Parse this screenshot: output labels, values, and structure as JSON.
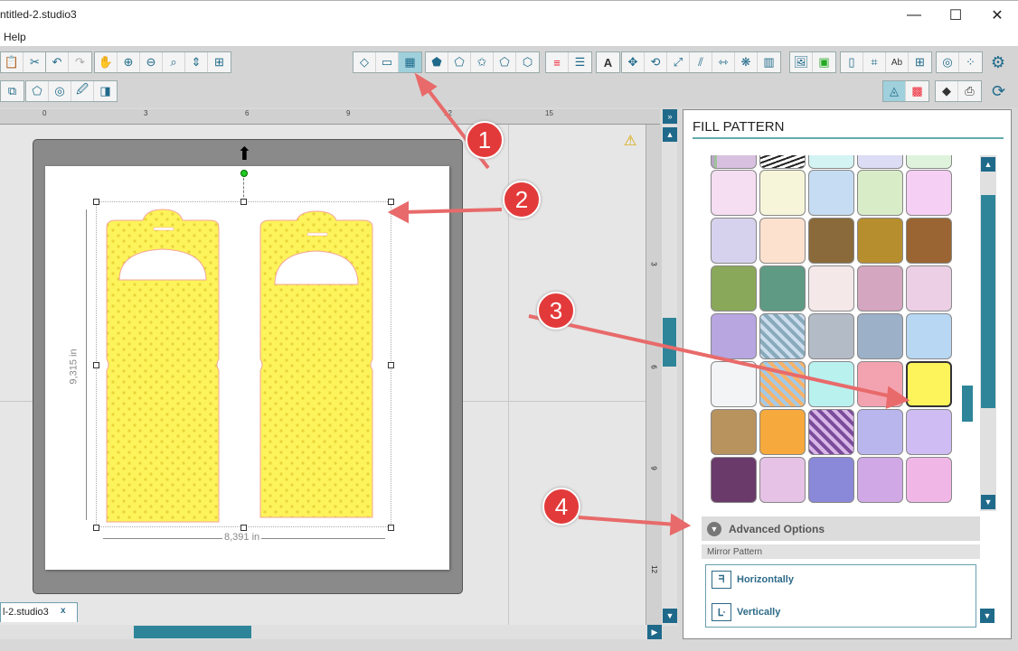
{
  "window": {
    "title": "ntitled-2.studio3",
    "minimize": "—",
    "maximize": "☐",
    "close": "✕"
  },
  "menu": {
    "help": "Help"
  },
  "ruler": {
    "h_ticks": [
      "0",
      "3",
      "6",
      "9",
      "12",
      "15"
    ],
    "v_ticks": [
      "3",
      "6",
      "9",
      "12"
    ]
  },
  "canvas": {
    "height_label": "9,315 in",
    "width_label": "8,391 in",
    "warning_icon": "⚠"
  },
  "document_tab": {
    "label": "l-2.studio3",
    "close": "x"
  },
  "panel": {
    "title": "FILL PATTERN",
    "advanced_options": "Advanced Options",
    "mirror_pattern": "Mirror Pattern",
    "horizontally": "Horizontally",
    "vertically": "Vertically"
  },
  "annotations": [
    "1",
    "2",
    "3",
    "4"
  ],
  "colors": {
    "accent": "#1f6a8a",
    "selected_fill": "#fdf35a",
    "annotation": "#e23a3a"
  }
}
